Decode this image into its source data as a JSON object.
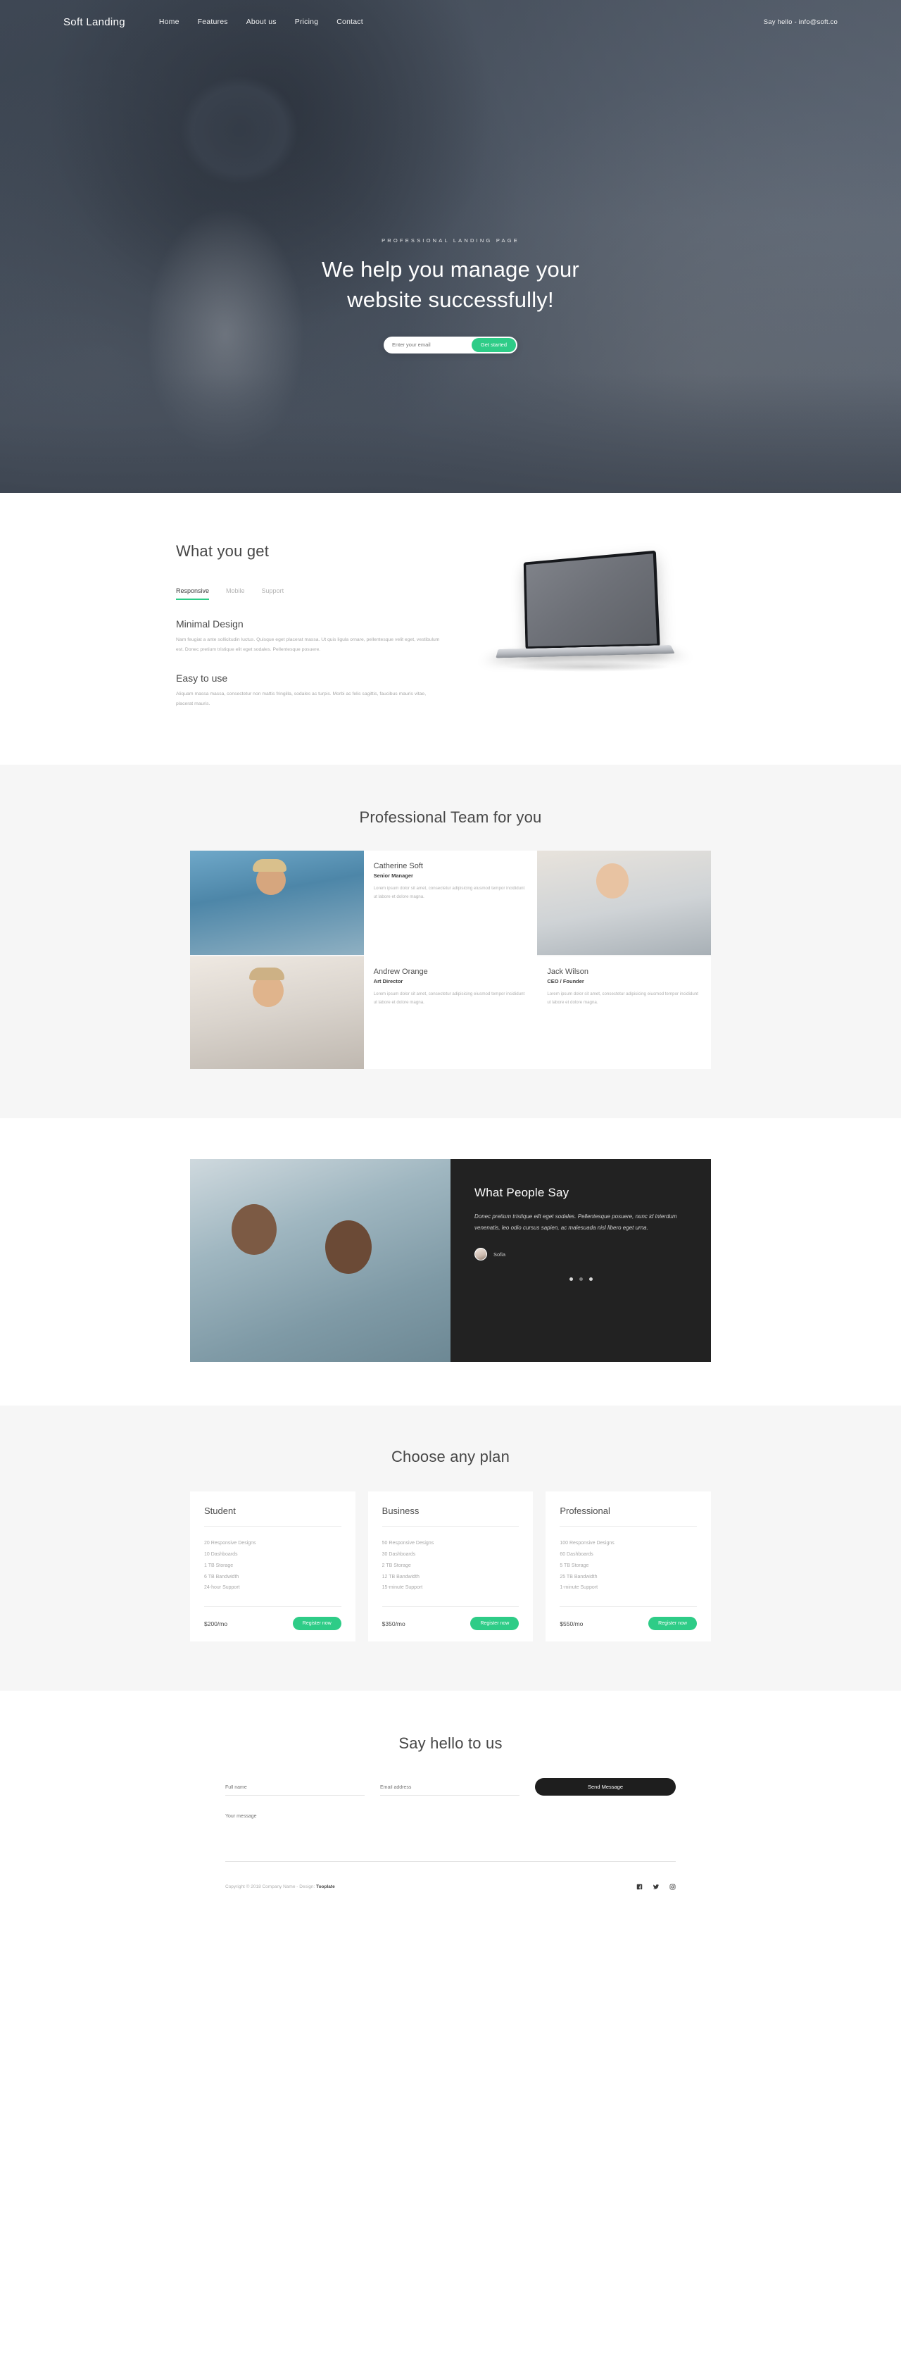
{
  "nav": {
    "brand": "Soft Landing",
    "links": [
      {
        "label": "Home"
      },
      {
        "label": "Features"
      },
      {
        "label": "About us"
      },
      {
        "label": "Pricing"
      },
      {
        "label": "Contact"
      }
    ],
    "contact": "Say hello - info@soft.co"
  },
  "hero": {
    "eyebrow": "PROFESSIONAL LANDING PAGE",
    "title_line1": "We help you manage your",
    "title_line2": "website successfully!",
    "email_placeholder": "Enter your email",
    "cta": "Get started"
  },
  "features": {
    "title": "What you get",
    "tabs": [
      {
        "label": "Responsive",
        "active": true
      },
      {
        "label": "Mobile",
        "active": false
      },
      {
        "label": "Support",
        "active": false
      }
    ],
    "blocks": [
      {
        "heading": "Minimal Design",
        "body": "Nam feugiat a ante sollicitudin luctus. Quisque eget placerat massa. Ut quis ligula ornare, pellentesque velit eget, vestibulum est. Donec pretium tristique elit eget sodales. Pellentesque posuere."
      },
      {
        "heading": "Easy to use",
        "body": "Aliquam massa massa, consectetur non mattis fringilla, sodales ac turpis. Morbi ac felis sagittis, faucibus mauris vitae, placerat mauris."
      }
    ]
  },
  "team": {
    "title": "Professional Team for you",
    "members": [
      {
        "name": "Catherine Soft",
        "role": "Senior Manager",
        "bio": "Lorem ipsum dolor sit amet, consectetur adipisicing eiusmod tempor incididunt ut labore et dolore magna."
      },
      {
        "name": "Andrew Orange",
        "role": "Art Director",
        "bio": "Lorem ipsum dolor sit amet, consectetur adipisicing eiusmod tempor incididunt ut labore et dolore magna."
      },
      {
        "name": "Jack Wilson",
        "role": "CEO / Founder",
        "bio": "Lorem ipsum dolor sit amet, consectetur adipisicing eiusmod tempor incididunt ut labore et dolore magna."
      }
    ]
  },
  "testimonial": {
    "title": "What People Say",
    "quote": "Donec pretium tristique elit eget sodales. Pellentesque posuere, nunc id interdum venenatis, leo odio cursus sapien, ac malesuada nisl libero eget urna.",
    "author": "Sofia",
    "dots": 3,
    "active_dot": 1
  },
  "pricing": {
    "title": "Choose any plan",
    "plans": [
      {
        "name": "Student",
        "features": [
          "20 Responsive Designs",
          "10 Dashboards",
          "1 TB Storage",
          "6 TB Bandwidth",
          "24-hour Support"
        ],
        "price": "$200/mo",
        "button": "Register now"
      },
      {
        "name": "Business",
        "features": [
          "50 Responsive Designs",
          "30 Dashboards",
          "2 TB Storage",
          "12 TB Bandwidth",
          "15-minute Support"
        ],
        "price": "$350/mo",
        "button": "Register now"
      },
      {
        "name": "Professional",
        "features": [
          "100 Responsive Designs",
          "60 Dashboards",
          "5 TB Storage",
          "25 TB Bandwidth",
          "1-minute Support"
        ],
        "price": "$550/mo",
        "button": "Register now"
      }
    ]
  },
  "contact": {
    "title": "Say hello to us",
    "fullname_placeholder": "Full name",
    "email_placeholder": "Email address",
    "message_placeholder": "Your message",
    "send_label": "Send Message"
  },
  "footer": {
    "copyright_pre": "Copyright © 2018 Company Name - Design: ",
    "copyright_brand": "Tooplate",
    "socials": [
      "facebook-icon",
      "twitter-icon",
      "instagram-icon"
    ]
  },
  "colors": {
    "accent_green": "#2ecc87",
    "dark": "#222222",
    "hero_overlay": "#55616f"
  }
}
